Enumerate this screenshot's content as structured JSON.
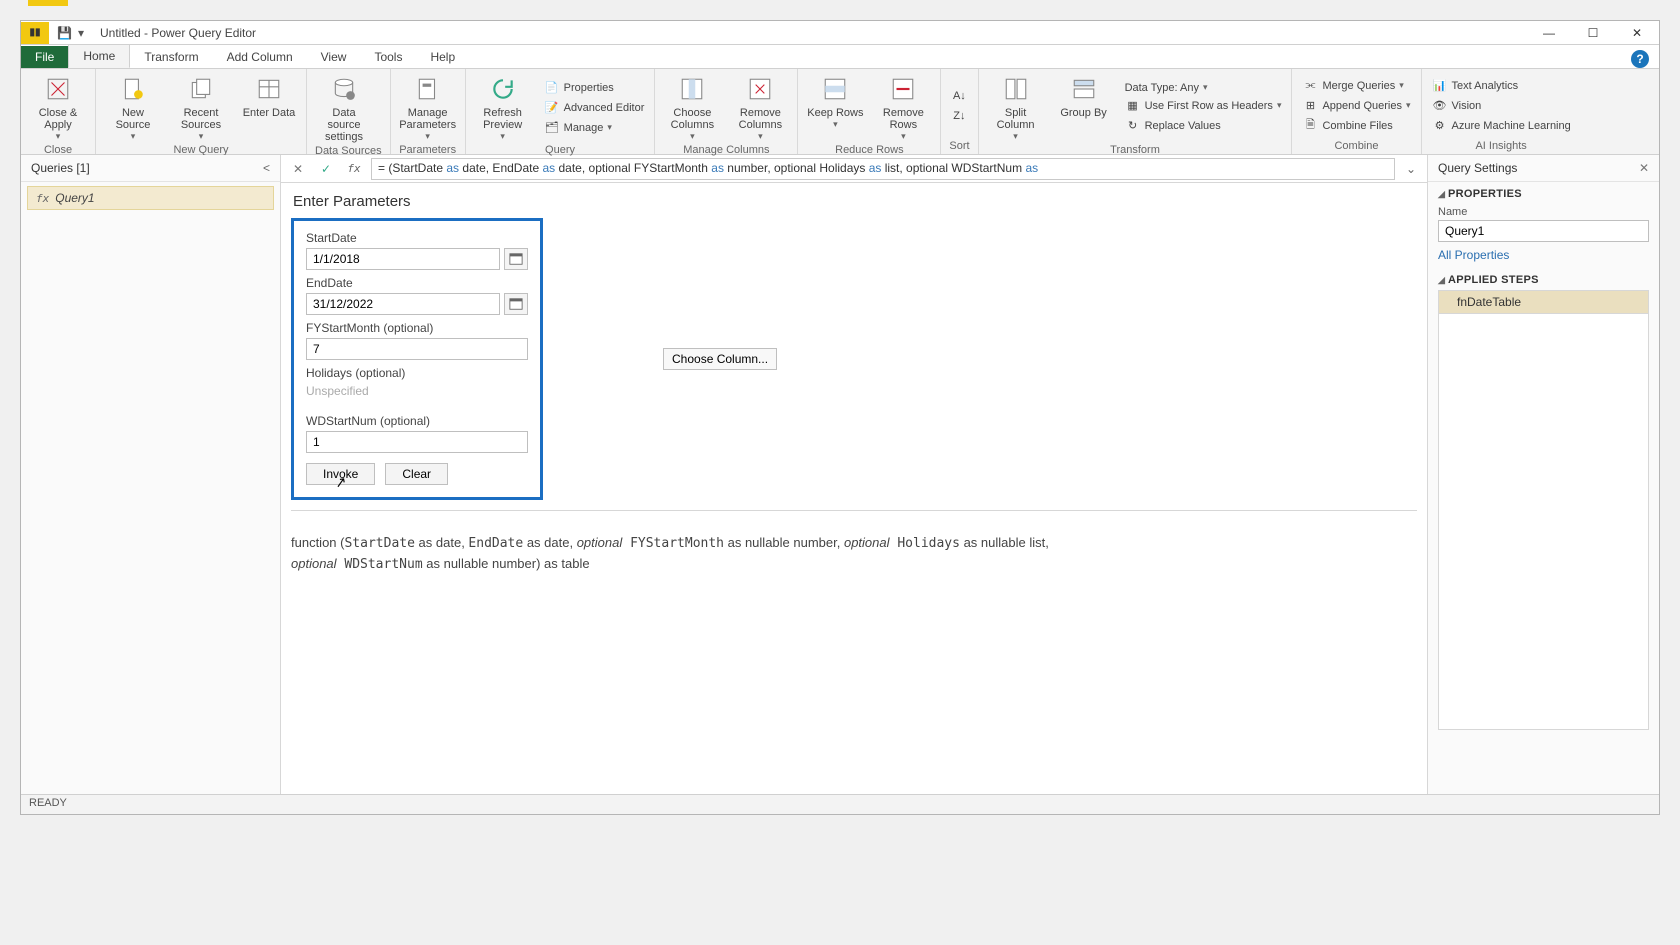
{
  "window": {
    "title": "Untitled - Power Query Editor"
  },
  "tabs": {
    "file": "File",
    "home": "Home",
    "transform": "Transform",
    "addcolumn": "Add Column",
    "view": "View",
    "tools": "Tools",
    "help": "Help"
  },
  "ribbon": {
    "close": {
      "close_apply": "Close &\nApply",
      "group": "Close"
    },
    "newquery": {
      "new_source": "New\nSource",
      "recent_sources": "Recent\nSources",
      "enter_data": "Enter\nData",
      "group": "New Query"
    },
    "datasources": {
      "ds_settings": "Data source\nsettings",
      "group": "Data Sources"
    },
    "parameters": {
      "manage_params": "Manage\nParameters",
      "group": "Parameters"
    },
    "query": {
      "refresh": "Refresh\nPreview",
      "properties": "Properties",
      "adv_editor": "Advanced Editor",
      "manage": "Manage",
      "group": "Query"
    },
    "manage_cols": {
      "choose": "Choose\nColumns",
      "remove": "Remove\nColumns",
      "group": "Manage Columns"
    },
    "reduce_rows": {
      "keep": "Keep\nRows",
      "remove": "Remove\nRows",
      "group": "Reduce Rows"
    },
    "sort": {
      "group": "Sort"
    },
    "transform": {
      "split": "Split\nColumn",
      "groupby": "Group\nBy",
      "datatype": "Data Type: Any",
      "firstrow": "Use First Row as Headers",
      "replace": "Replace Values",
      "group": "Transform"
    },
    "combine": {
      "merge": "Merge Queries",
      "append": "Append Queries",
      "files": "Combine Files",
      "group": "Combine"
    },
    "ai": {
      "text": "Text Analytics",
      "vision": "Vision",
      "aml": "Azure Machine Learning",
      "group": "AI Insights"
    }
  },
  "queries": {
    "header": "Queries [1]",
    "item1": "Query1"
  },
  "formula": {
    "prefix": "= (StartDate ",
    "as1": "as",
    "t1": " date",
    "sep1": ", EndDate ",
    "as2": "as",
    "t2": " date",
    "sep2": ", optional FYStartMonth ",
    "as3": "as",
    "t3": " number",
    "sep3": ", optional Holidays ",
    "as4": "as",
    "t4": " list",
    "sep4": ", optional WDStartNum ",
    "as5": "as"
  },
  "params": {
    "title": "Enter Parameters",
    "start_label": "StartDate",
    "start_value": "1/1/2018",
    "end_label": "EndDate",
    "end_value": "31/12/2022",
    "fy_label": "FYStartMonth (optional)",
    "fy_value": "7",
    "hol_label": "Holidays (optional)",
    "hol_placeholder": "Unspecified",
    "choose_col": "Choose Column...",
    "wd_label": "WDStartNum (optional)",
    "wd_value": "1",
    "invoke": "Invoke",
    "clear": "Clear"
  },
  "signature": {
    "l1a": "function (",
    "l1b": "StartDate",
    "l1c": " as date, ",
    "l1d": "EndDate",
    "l1e": " as date, ",
    "l1f": "optional",
    "l1g": " FYStartMonth",
    "l1h": " as nullable number, ",
    "l1i": "optional",
    "l1j": " Holidays",
    "l1k": " as nullable list, ",
    "l2a": "optional",
    "l2b": " WDStartNum",
    "l2c": " as nullable number) as table"
  },
  "settings": {
    "header": "Query Settings",
    "properties": "PROPERTIES",
    "name_label": "Name",
    "name_value": "Query1",
    "all_props": "All Properties",
    "applied": "APPLIED STEPS",
    "step1": "fnDateTable"
  },
  "status": {
    "ready": "READY"
  }
}
